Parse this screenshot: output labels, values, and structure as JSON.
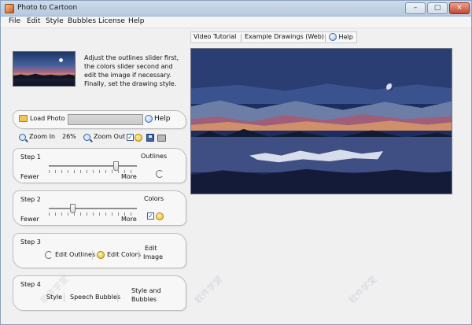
{
  "window": {
    "title": "Photo to Cartoon",
    "controls": [
      "–",
      "▢",
      "×"
    ]
  },
  "menu": [
    "File",
    "Edit",
    "Style",
    "Bubbles",
    "License",
    "Help"
  ],
  "intro": {
    "text": "Adjust the outlines slider first, the colors slider second and edit the image if necessary. Finally, set the drawing style."
  },
  "toolbar": {
    "load_label": "Load Photo",
    "help_label": "Help",
    "zoom_in_label": "Zoom In",
    "zoom_value": "26%",
    "zoom_out_label": "Zoom Out",
    "progress": 0
  },
  "steps": {
    "step1": {
      "title": "Step 1",
      "name": "Outlines",
      "fewer": "Fewer",
      "more": "More",
      "slider_value": 0.78
    },
    "step2": {
      "title": "Step 2",
      "name": "Colors",
      "fewer": "Fewer",
      "more": "More",
      "slider_value": 0.26
    },
    "step3": {
      "title": "Step 3",
      "edit_outlines": "Edit Outlines",
      "edit_colors": "Edit Colors",
      "edit_image_1": "Edit",
      "edit_image_2": "Image"
    },
    "step4": {
      "title": "Step 4",
      "style": "Style",
      "speech_bubbles": "Speech Bubbles",
      "style_and_1": "Style and",
      "style_and_2": "Bubbles"
    }
  },
  "tabs": {
    "video_tutorial": "Video Tutorial",
    "example_drawings": "Example Drawings (Web)",
    "help": "Help"
  },
  "watermark": "软件学堂",
  "colors": {
    "window_bg": "#f0f0f0",
    "canvas_bg": "#1c2d5f",
    "accent": "#3f6fb4"
  }
}
